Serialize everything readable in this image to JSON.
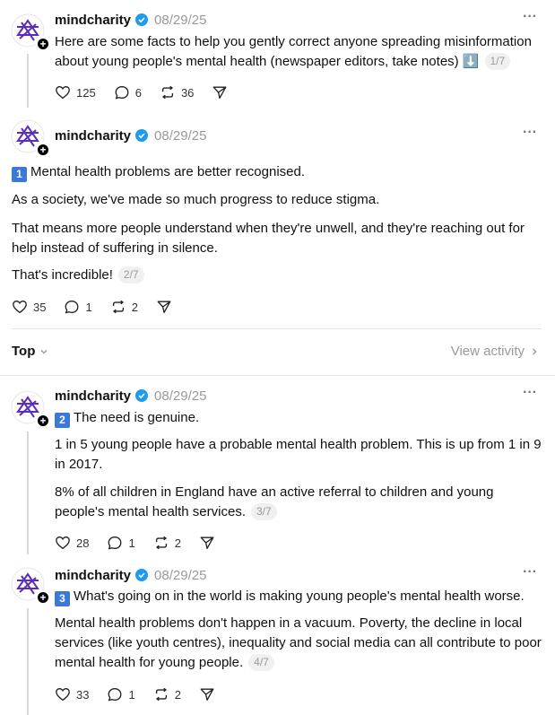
{
  "posts": [
    {
      "username": "mindcharity",
      "date": "08/29/25",
      "text": "Here are some facts to help you gently correct anyone spreading misinformation about young people's mental health (newspaper editors, take notes) ⬇️",
      "counter": "1/7",
      "likes": "125",
      "replies": "6",
      "reposts": "36"
    },
    {
      "username": "mindcharity",
      "date": "08/29/25",
      "keycap": "1",
      "headline": "Mental health problems are better recognised.",
      "paragraphs": [
        "As a society, we've made so much progress to reduce stigma.",
        "That means more people understand when they're unwell, and they're reaching out for help instead of suffering in silence.",
        "That's incredible!"
      ],
      "counter": "2/7",
      "likes": "35",
      "replies": "1",
      "reposts": "2"
    },
    {
      "username": "mindcharity",
      "date": "08/29/25",
      "keycap": "2",
      "headline": "The need is genuine.",
      "paragraphs": [
        "1 in 5 young people have a probable mental health problem. This is up from 1 in 9 in 2017.",
        "8% of all children in England have an active referral to children and young people's mental health services."
      ],
      "counter": "3/7",
      "likes": "28",
      "replies": "1",
      "reposts": "2"
    },
    {
      "username": "mindcharity",
      "date": "08/29/25",
      "keycap": "3",
      "headline": "What's going on in the world is making young people's mental health worse.",
      "paragraphs": [
        "Mental health problems don't happen in a vacuum. Poverty, the decline in local services (like youth centres), inequality and social media can all contribute to poor mental health for young people."
      ],
      "counter": "4/7",
      "likes": "33",
      "replies": "1",
      "reposts": "2"
    }
  ],
  "sort": {
    "label": "Top",
    "view_activity": "View activity"
  },
  "icons": {
    "more": "more-icon",
    "like": "heart-icon",
    "reply": "comment-icon",
    "repost": "repost-icon",
    "share": "share-icon",
    "verified": "verified-badge-icon",
    "follow": "plus-icon",
    "keycap_down": "down-arrow-keycap-icon"
  },
  "colors": {
    "verified": "#1d9bf0",
    "keycap": "#3b78d8",
    "muted": "#999999",
    "avatar": "#5b2db8"
  }
}
